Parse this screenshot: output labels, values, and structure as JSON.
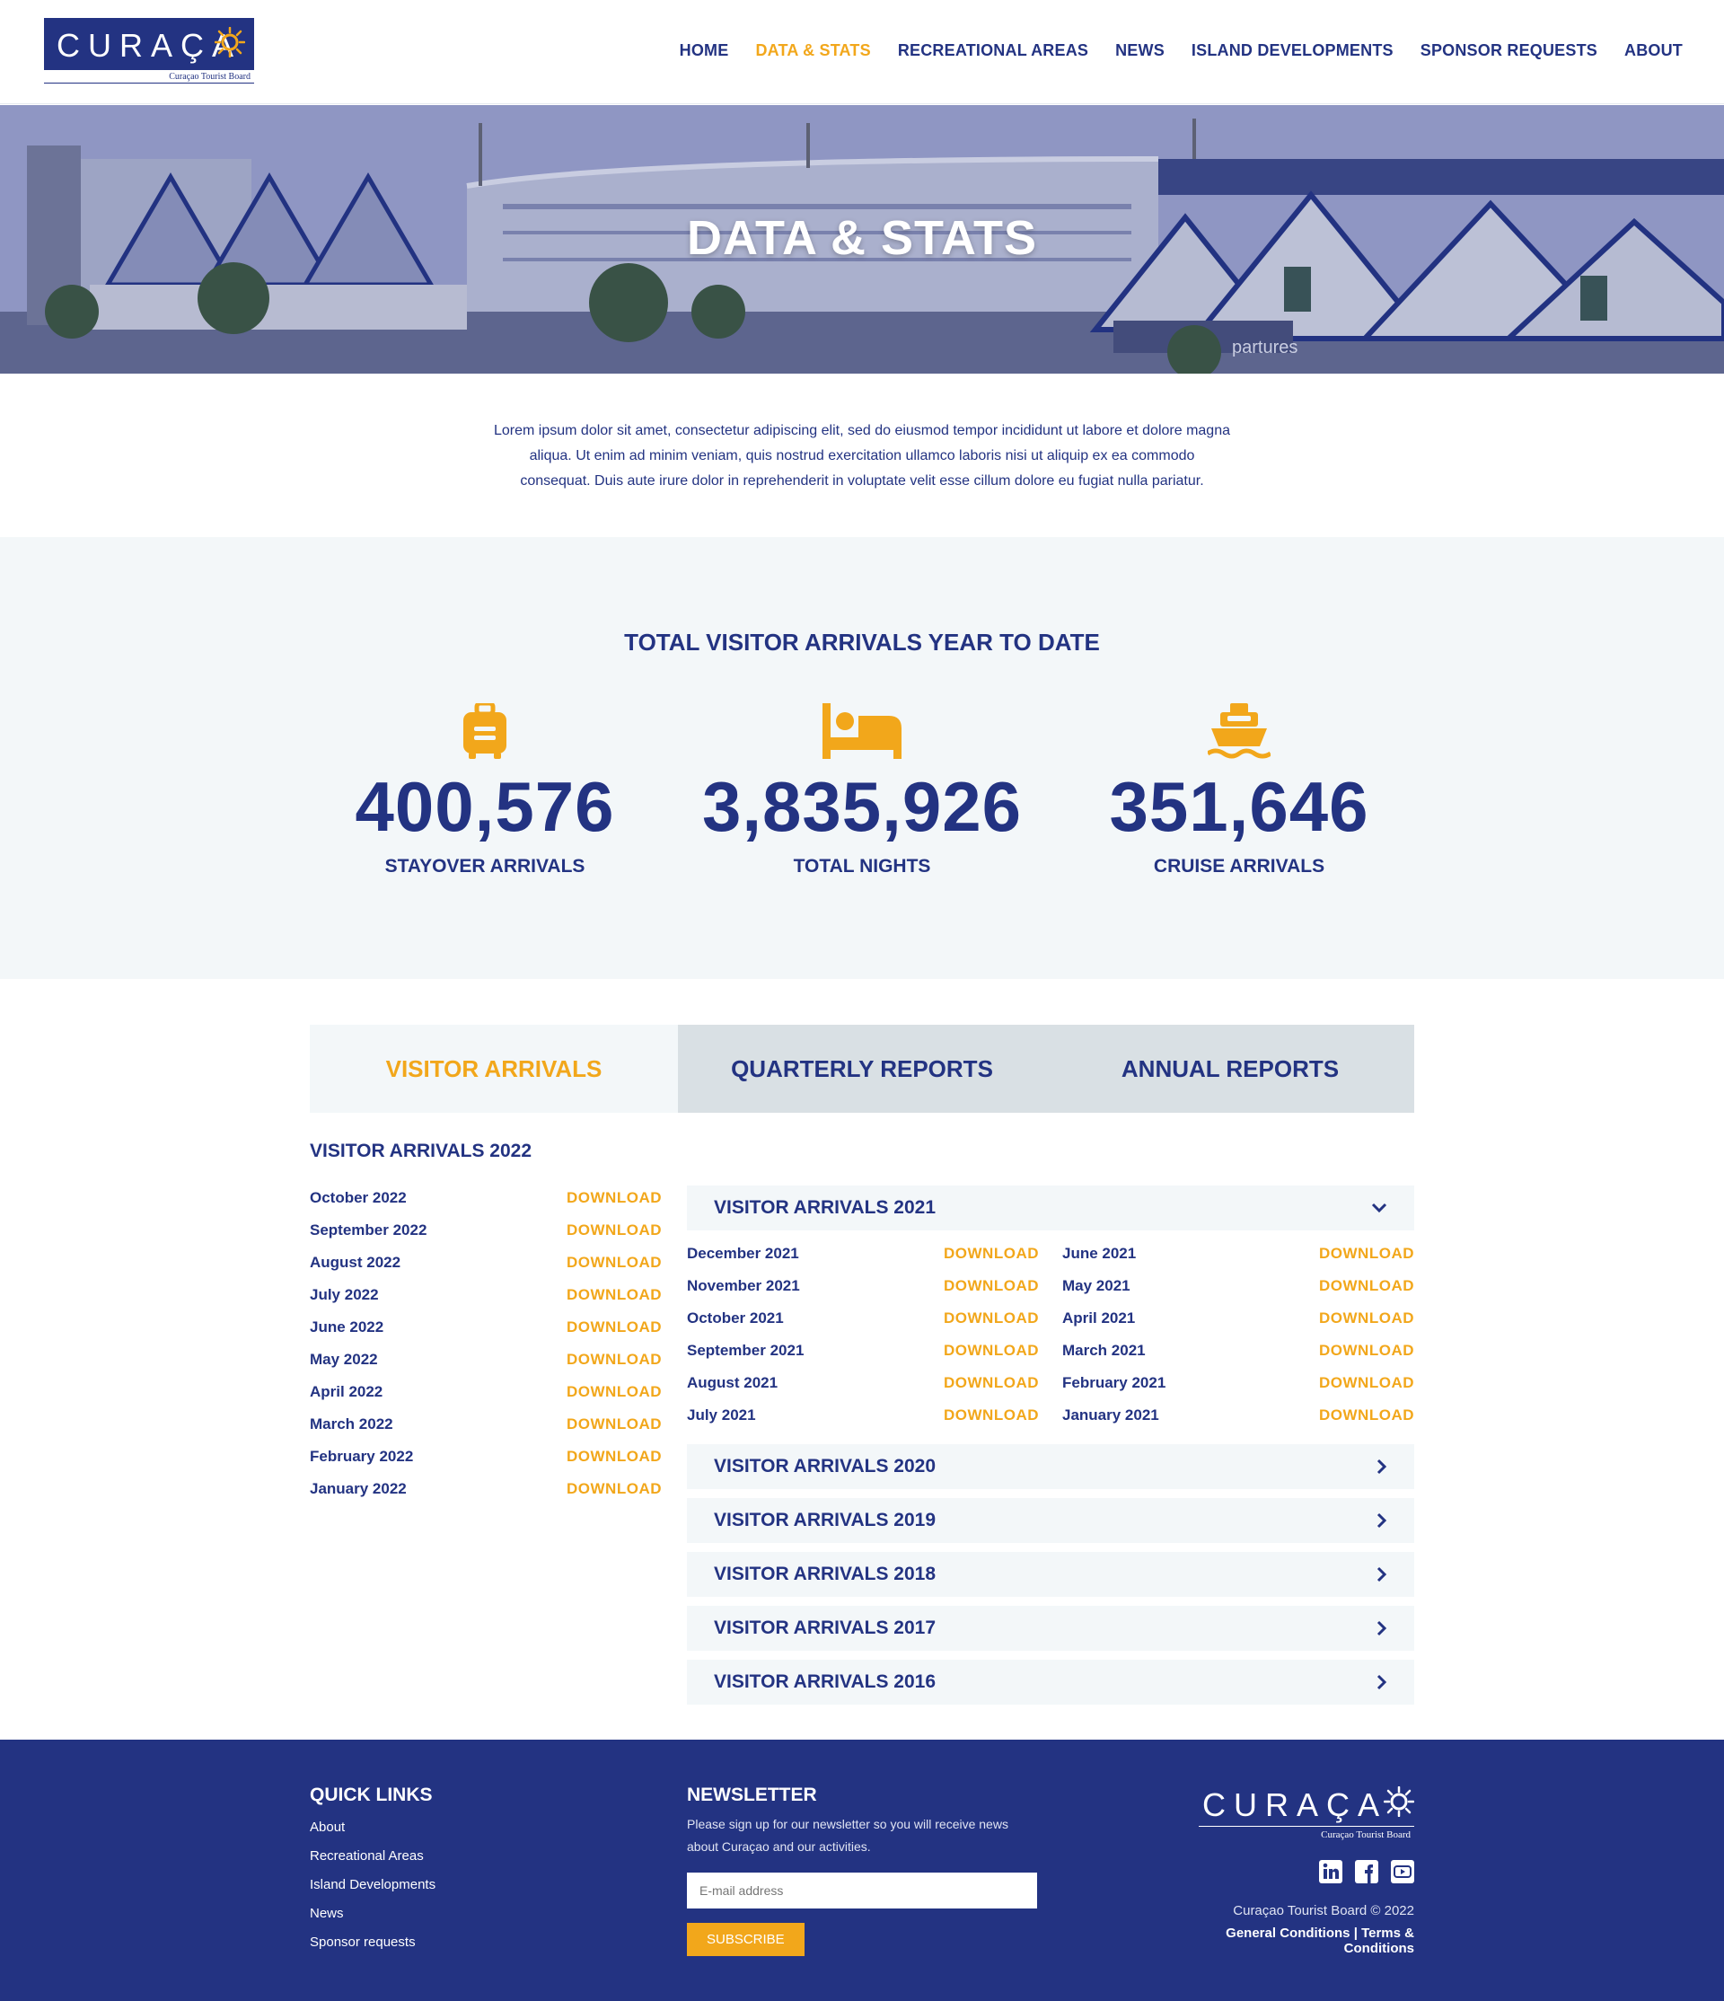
{
  "header": {
    "logo_text": "CURAÇA",
    "logo_subtitle": "Curaçao Tourist Board",
    "nav": [
      {
        "label": "HOME",
        "active": false
      },
      {
        "label": "DATA & STATS",
        "active": true
      },
      {
        "label": "RECREATIONAL AREAS",
        "active": false
      },
      {
        "label": "NEWS",
        "active": false
      },
      {
        "label": "ISLAND DEVELOPMENTS",
        "active": false
      },
      {
        "label": "SPONSOR REQUESTS",
        "active": false
      },
      {
        "label": "ABOUT",
        "active": false
      }
    ]
  },
  "hero": {
    "title": "DATA & STATS",
    "sign_text": "partures"
  },
  "intro": "Lorem ipsum dolor sit amet, consectetur adipiscing elit, sed do eiusmod tempor incididunt ut labore et dolore magna aliqua. Ut enim ad minim veniam, quis nostrud exercitation ullamco laboris nisi ut aliquip ex ea commodo consequat. Duis aute irure dolor in reprehenderit in voluptate velit esse cillum dolore eu fugiat nulla pariatur.",
  "stats": {
    "title": "TOTAL VISITOR ARRIVALS YEAR TO DATE",
    "items": [
      {
        "icon": "suitcase-icon",
        "value": "400,576",
        "label": "STAYOVER ARRIVALS"
      },
      {
        "icon": "bed-icon",
        "value": "3,835,926",
        "label": "TOTAL NIGHTS"
      },
      {
        "icon": "ship-icon",
        "value": "351,646",
        "label": "CRUISE ARRIVALS"
      }
    ]
  },
  "tabs": [
    {
      "label": "VISITOR ARRIVALS",
      "active": true
    },
    {
      "label": "QUARTERLY REPORTS",
      "active": false
    },
    {
      "label": "ANNUAL REPORTS",
      "active": false
    }
  ],
  "download_label": "DOWNLOAD",
  "year_2022": {
    "title": "VISITOR ARRIVALS 2022",
    "months": [
      "October 2022",
      "September 2022",
      "August 2022",
      "July 2022",
      "June 2022",
      "May 2022",
      "April 2022",
      "March 2022",
      "February 2022",
      "January 2022"
    ]
  },
  "accordion": {
    "open": {
      "title": "VISITOR ARRIVALS 2021",
      "left": [
        "December 2021",
        "November 2021",
        "October 2021",
        "September 2021",
        "August 2021",
        "July 2021"
      ],
      "right": [
        "June 2021",
        "May 2021",
        "April 2021",
        "March 2021",
        "February 2021",
        "January 2021"
      ]
    },
    "closed": [
      "VISITOR ARRIVALS 2020",
      "VISITOR ARRIVALS 2019",
      "VISITOR ARRIVALS 2018",
      "VISITOR ARRIVALS 2017",
      "VISITOR ARRIVALS 2016"
    ]
  },
  "footer": {
    "quick_links_title": "QUICK LINKS",
    "quick_links": [
      "About",
      "Recreational Areas",
      "Island Developments",
      "News",
      "Sponsor requests"
    ],
    "newsletter_title": "NEWSLETTER",
    "newsletter_text": "Please sign up for our newsletter so you will receive news about Curaçao and our activities.",
    "email_placeholder": "E-mail address",
    "subscribe_label": "SUBSCRIBE",
    "logo_text": "CURAÇA",
    "logo_subtitle": "Curaçao Tourist Board",
    "copyright": "Curaçao Tourist Board © 2022",
    "general_conditions": "General Conditions",
    "separator": "|",
    "terms": "Terms & Conditions"
  },
  "colors": {
    "navy": "#233382",
    "orange": "#f2a71b",
    "light_bg": "#f3f7f9",
    "tab_bg": "#d9e0e4"
  }
}
